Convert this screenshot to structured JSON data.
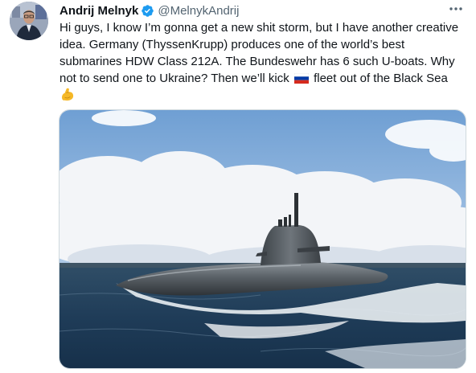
{
  "tweet": {
    "author_name": "Andrij Melnyk",
    "handle": "@MelnykAndrij",
    "text_lines": [
      "Hi guys, I know I’m gonna get a new shit storm, but I have another creative",
      "idea. Germany (ThyssenKrupp) produces one of the world’s best",
      "submarines HDW Class 212A. The Bundeswehr has 6 such U-boats. Why",
      "not to send one to Ukraine? Then we’ll kick"
    ],
    "text_after_flag": " fleet out of the Black Sea",
    "icons": {
      "verified": "verified-badge-icon",
      "more": "more-options-icon",
      "flag": "russia-flag-icon",
      "emoji": "flexed-biceps-icon"
    },
    "colors": {
      "text": "#0f1419",
      "secondary": "#536471",
      "verified": "#1d9bf0"
    }
  }
}
